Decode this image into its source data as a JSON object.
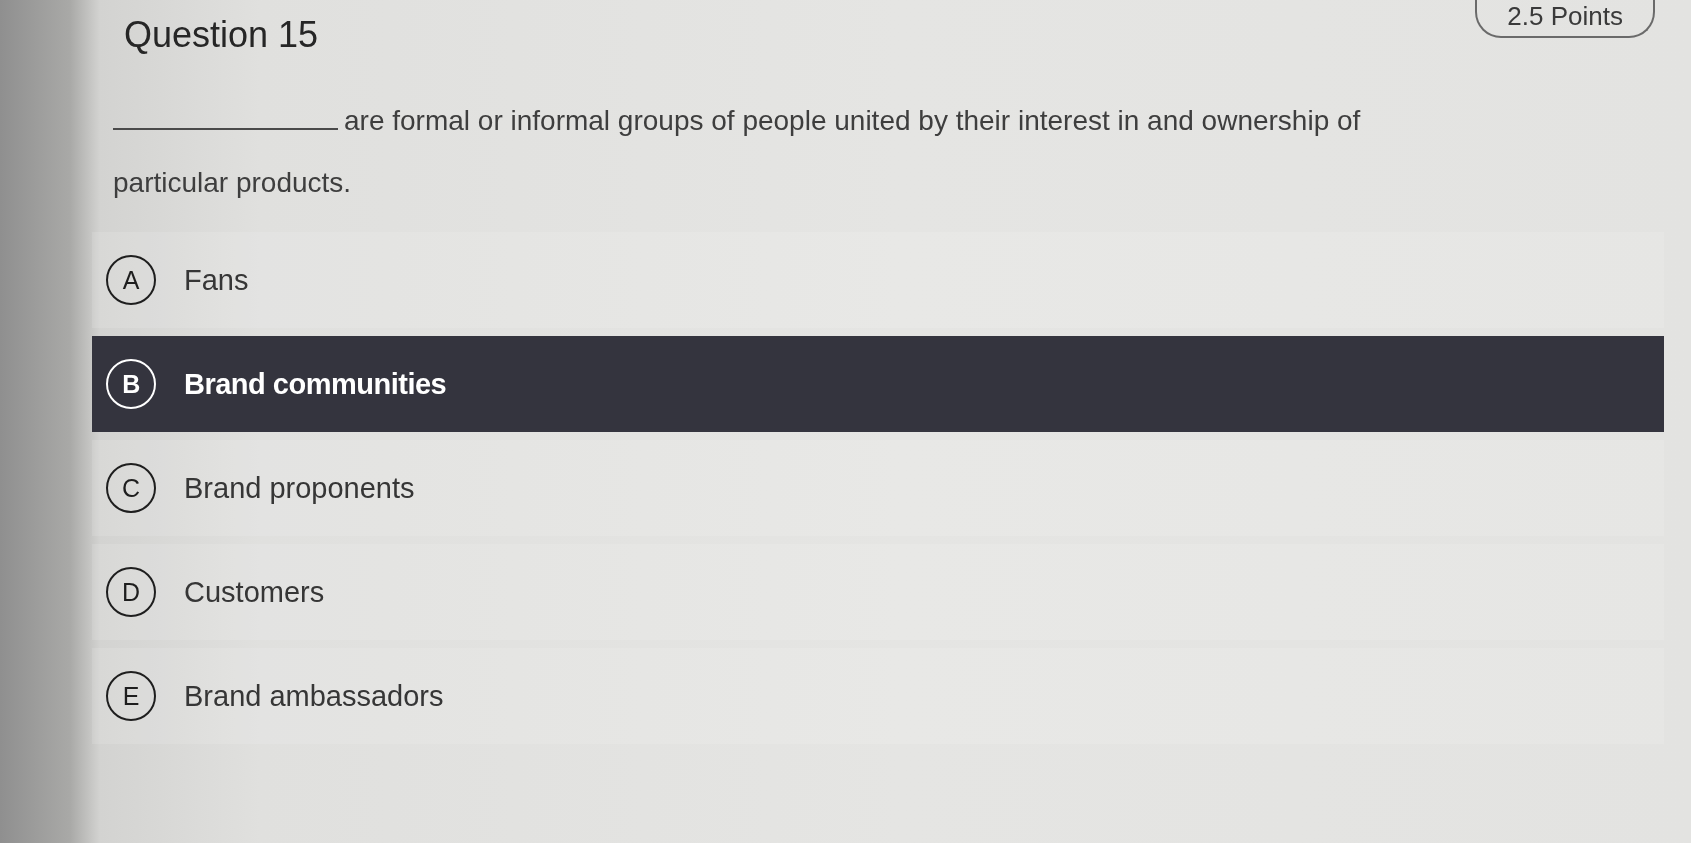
{
  "question": {
    "title": "Question 15",
    "points": "2.5 Points",
    "stem": "are formal or informal groups of people united by their interest in and ownership of particular products."
  },
  "options": [
    {
      "letter": "A",
      "label": "Fans",
      "selected": false
    },
    {
      "letter": "B",
      "label": "Brand communities",
      "selected": true
    },
    {
      "letter": "C",
      "label": "Brand proponents",
      "selected": false
    },
    {
      "letter": "D",
      "label": "Customers",
      "selected": false
    },
    {
      "letter": "E",
      "label": "Brand ambassadors",
      "selected": false
    }
  ]
}
